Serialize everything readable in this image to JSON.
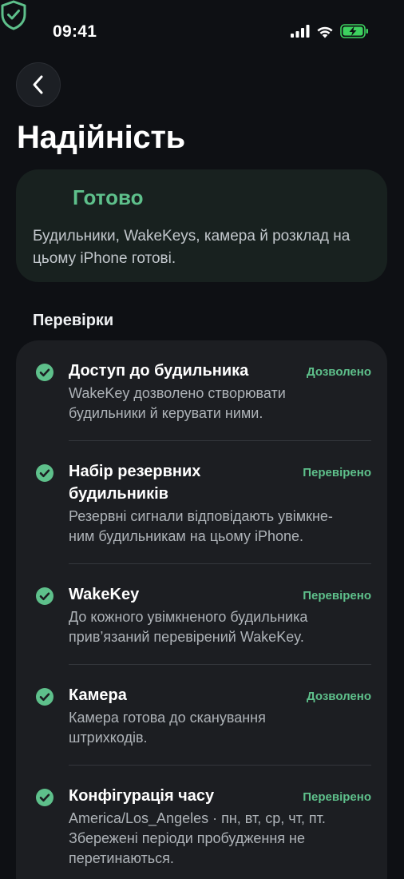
{
  "status_bar": {
    "time": "09:41"
  },
  "header": {
    "title": "Надійність"
  },
  "status": {
    "heading": "Готово",
    "description": "Будильники, WakeKeys, камера й розклад на цьому iPhone готові.",
    "accent_color": "#5ec08b"
  },
  "checks": {
    "section_title": "Перевірки",
    "items": [
      {
        "title": "Доступ до будильника",
        "badge": "Дозволено",
        "desc_line1": "WakeKey дозволено створювати",
        "desc_line2": "будильники й керувати ними."
      },
      {
        "title_line1": "Набір резервних",
        "title_line2": "будильників",
        "badge": "Перевірено",
        "desc_line1": "Резервні сигнали відповідають увімкне-",
        "desc_line2": "ним будильникам на цьому iPhone."
      },
      {
        "title": "WakeKey",
        "badge": "Перевірено",
        "desc_line1": "До кожного увімкненого будильника",
        "desc_line2": "прив’язаний перевірений WakeKey."
      },
      {
        "title": "Камера",
        "badge": "Дозволено",
        "desc_line1": "Камера готова до сканування",
        "desc_line2": "штрихкодів."
      },
      {
        "title": "Конфігурація часу",
        "badge": "Перевірено",
        "desc_line1": "America/Los_Angeles · пн, вт, ср, чт, пт.",
        "desc_line2": "Збережені періоди пробудження не",
        "desc_line3": "перетинаються."
      }
    ]
  }
}
